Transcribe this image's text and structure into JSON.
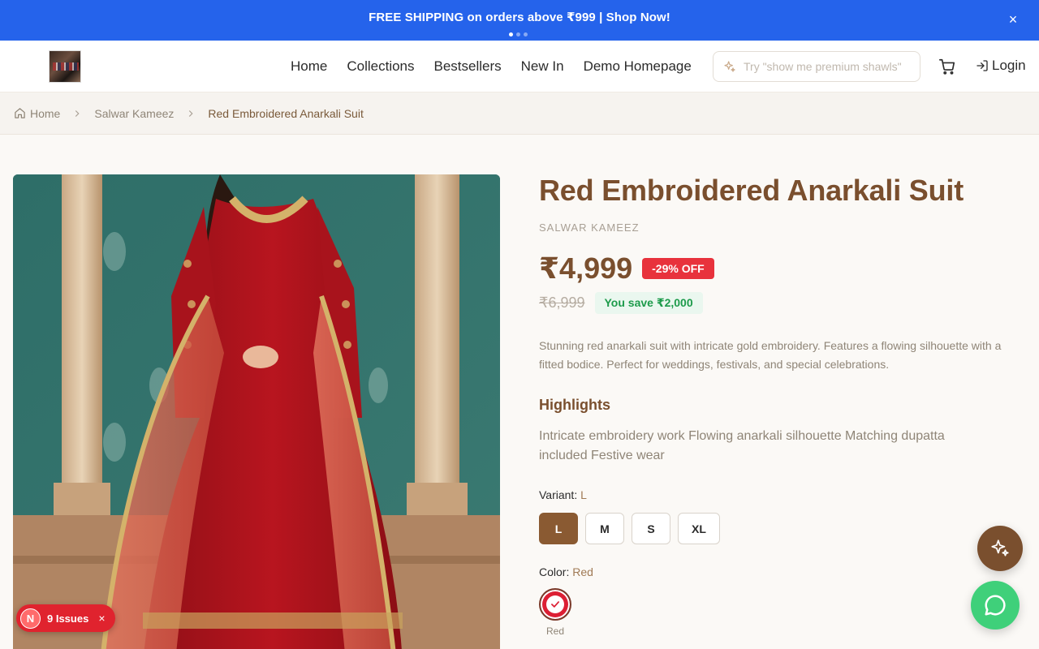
{
  "announcement": {
    "text": "FREE SHIPPING on orders above ₹999 | Shop Now!",
    "close_icon": "×",
    "dots": 3,
    "active_dot": 0
  },
  "header": {
    "logo_icon": "store-logo",
    "nav": [
      "Home",
      "Collections",
      "Bestsellers",
      "New In",
      "Demo Homepage"
    ],
    "search_placeholder": "Try \"show me premium shawls\"",
    "cart_icon": "cart-icon",
    "login_label": "Login"
  },
  "breadcrumb": {
    "home": "Home",
    "category": "Salwar Kameez",
    "current": "Red Embroidered Anarkali Suit"
  },
  "product": {
    "title": "Red Embroidered Anarkali Suit",
    "category": "SALWAR KAMEEZ",
    "price": "₹4,999",
    "discount": "-29% OFF",
    "old_price": "₹6,999",
    "savings": "You save ₹2,000",
    "description": "Stunning red anarkali suit with intricate gold embroidery. Features a flowing silhouette with a fitted bodice. Perfect for weddings, festivals, and special celebrations.",
    "highlights_title": "Highlights",
    "highlights": "Intricate embroidery work Flowing anarkali silhouette Matching dupatta included Festive wear",
    "variant_label": "Variant:",
    "variant_selected": "L",
    "sizes": [
      "L",
      "M",
      "S",
      "XL"
    ],
    "color_label": "Color:",
    "color_selected": "Red",
    "colors": [
      {
        "name": "Red",
        "hex": "#dc1f34"
      }
    ]
  },
  "issues": {
    "badge": "N",
    "label": "9 Issues",
    "close": "×"
  },
  "colors": {
    "announcement_bg": "#2563eb",
    "brand_brown": "#7a4f2e",
    "discount_red": "#e8323c",
    "save_green": "#1d9b4b",
    "chat_green": "#3fd07a"
  }
}
